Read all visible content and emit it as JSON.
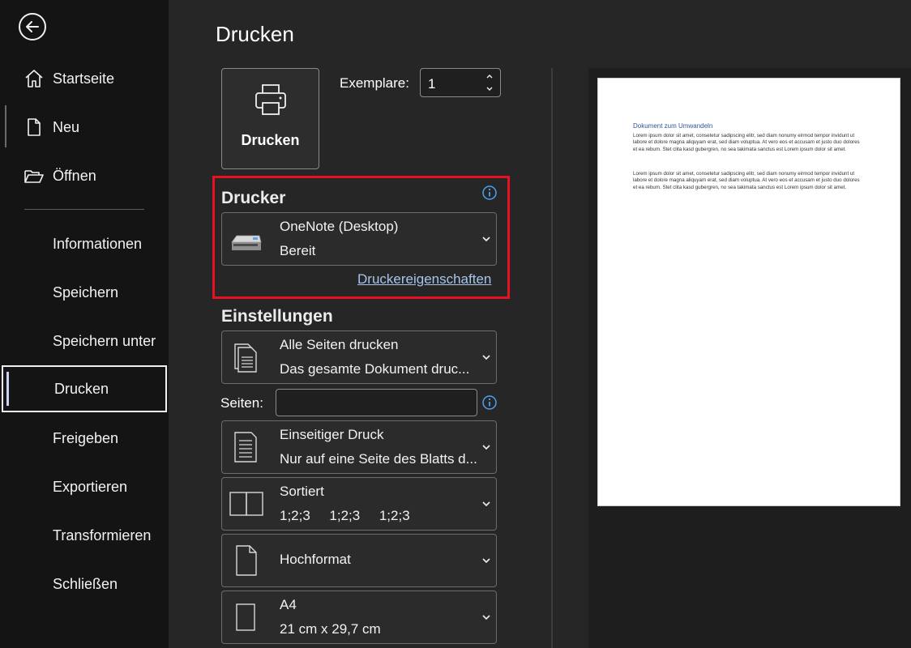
{
  "sidebar": {
    "items": [
      {
        "label": "Startseite"
      },
      {
        "label": "Neu"
      },
      {
        "label": "Öffnen"
      },
      {
        "label": "Informationen"
      },
      {
        "label": "Speichern"
      },
      {
        "label": "Speichern unter"
      },
      {
        "label": "Drucken"
      },
      {
        "label": "Freigeben"
      },
      {
        "label": "Exportieren"
      },
      {
        "label": "Transformieren"
      },
      {
        "label": "Schließen"
      }
    ]
  },
  "print": {
    "title": "Drucken",
    "button_label": "Drucken",
    "copies_label": "Exemplare:",
    "copies_value": "1"
  },
  "printer": {
    "heading": "Drucker",
    "name": "OneNote (Desktop)",
    "status": "Bereit",
    "properties_link": "Druckereigenschaften"
  },
  "settings": {
    "heading": "Einstellungen",
    "pages_label": "Seiten:",
    "pages_value": "",
    "options": [
      {
        "line1": "Alle Seiten drucken",
        "line2": "Das gesamte Dokument druc..."
      },
      {
        "line1": "Einseitiger Druck",
        "line2": "Nur auf eine Seite des Blatts d..."
      },
      {
        "line1": "Sortiert",
        "line2": "1;2;3     1;2;3     1;2;3"
      },
      {
        "line1": "Hochformat",
        "line2": ""
      },
      {
        "line1": "A4",
        "line2": "21 cm x 29,7 cm"
      }
    ]
  },
  "preview": {
    "doc_title": "Dokument zum Umwandeln",
    "paragraphs": [
      "Lorem ipsum dolor sit amet, consetetur sadipscing elitr, sed diam nonumy eirmod tempor invidunt ut labore et dolore magna aliquyam erat, sed diam voluptua. At vero eos et accusam et justo duo dolores et ea rebum. Stet clita kasd gubergren, no sea takimata sanctus est Lorem ipsum dolor sit amet.",
      "Lorem ipsum dolor sit amet, consetetur sadipscing elitr, sed diam nonumy eirmod tempor invidunt ut labore et dolore magna aliquyam erat, sed diam voluptua. At vero eos et accusam et justo duo dolores et ea rebum. Stet clita kasd gubergren, no sea takimata sanctus est Lorem ipsum dolor sit amet."
    ]
  },
  "colors": {
    "highlight_border": "#e81123",
    "link": "#a8c4ec",
    "info_icon": "#4ea1f3"
  }
}
